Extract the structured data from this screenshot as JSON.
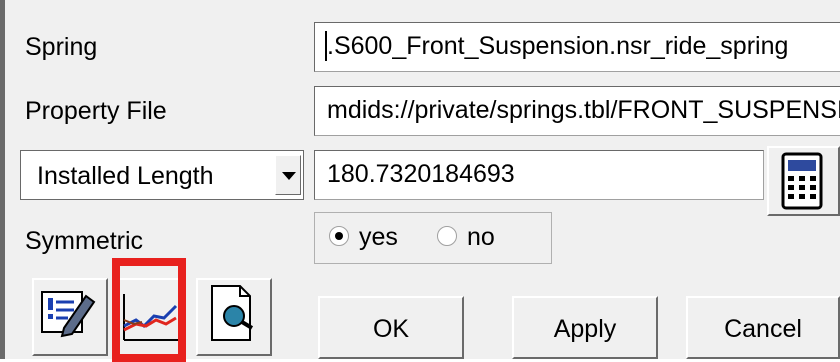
{
  "spring": {
    "label": "Spring",
    "value": ".S600_Front_Suspension.nsr_ride_spring"
  },
  "property_file": {
    "label": "Property File",
    "value": "mdids://private/springs.tbl/FRONT_SUSPENSION"
  },
  "preload": {
    "selected": "Installed Length",
    "value": "180.7320184693"
  },
  "symmetric": {
    "label": "Symmetric",
    "yes_label": "yes",
    "no_label": "no",
    "selected": "yes"
  },
  "toolbar": {
    "edit_icon": "edit-pencil-icon",
    "plot_icon": "curve-plot-icon",
    "view_icon": "view-file-icon"
  },
  "buttons": {
    "ok": "OK",
    "apply": "Apply",
    "cancel": "Cancel"
  },
  "colors": {
    "highlight": "#e8211e"
  }
}
